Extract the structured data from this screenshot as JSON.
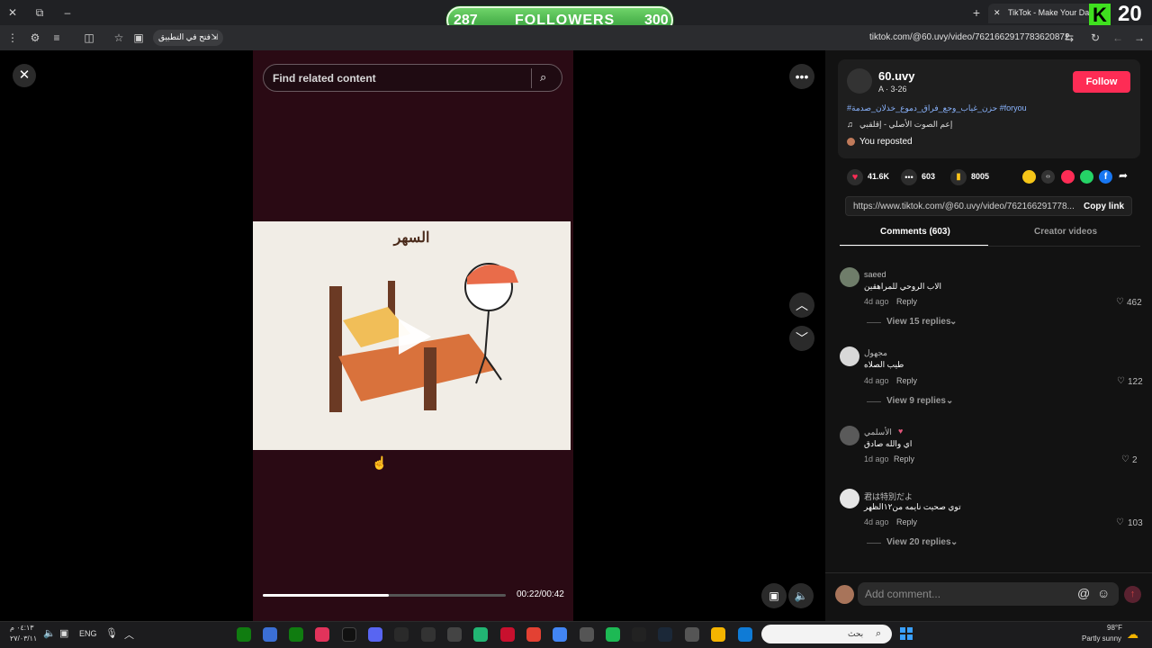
{
  "browser": {
    "tab_title": "TikTok - Make Your Day",
    "url": "tiktok.com/@60.uvy/video/7621662917783620872",
    "app_chip_label": "فتح في التطبيق",
    "new_tab_symbol": "+",
    "close_tab_symbol": "✕"
  },
  "overlay": {
    "followers_label": "FOLLOWERS",
    "followers_current": "287",
    "followers_goal": "300",
    "brand_number": "20",
    "brand_letter": "K"
  },
  "player": {
    "search_placeholder": "Find related content",
    "video_title_text": "السهر",
    "time": "00:22/00:42",
    "progress": 0.52
  },
  "author": {
    "username": "60.uvy",
    "subtitle": "A · 3-26",
    "follow_label": "Follow",
    "hashtags": "#حزن_غياب_وجع_فراق_دموع_خذلان_صدمة #foryou",
    "sound": "إعم الصوت الأصلي - إقلقبي",
    "repost_label": "You reposted"
  },
  "stats": {
    "likes": "41.6K",
    "comments": "603",
    "saves": "8005"
  },
  "share": {
    "link": "https://www.tiktok.com/@60.uvy/video/762166291778...",
    "copy_label": "Copy link"
  },
  "tabs": [
    {
      "label": "Comments (603)",
      "active": true
    },
    {
      "label": "Creator videos",
      "active": false
    }
  ],
  "comments": [
    {
      "name": "saeed",
      "text": "الاب الروحي للمراهقين",
      "age": "4d ago",
      "reply": "Reply",
      "likes": "462",
      "replies": "View 15 replies"
    },
    {
      "name": "مجهول",
      "text": "طيب الصلاه",
      "age": "4d ago",
      "reply": "Reply",
      "likes": "122",
      "replies": "View 9 replies"
    },
    {
      "name": "الأسلمي",
      "text": "اي والله صادق",
      "age": "1d ago",
      "reply": "Reply",
      "likes": "2",
      "replies": ""
    },
    {
      "name": "君は特別だよ",
      "text": "توي صحيت نايمه من١٢الظهر",
      "age": "4d ago",
      "reply": "Reply",
      "likes": "103",
      "replies": "View 20 replies"
    }
  ],
  "comment_box": {
    "placeholder": "Add comment..."
  },
  "taskbar": {
    "lang": "ENG",
    "time": "٠٤:١٣ م",
    "date": "٢٧/٠٣/١١",
    "search_text": "بحث",
    "weather_temp": "98°F",
    "weather_desc": "Partly sunny"
  },
  "colors": {
    "accent": "#fe2c55",
    "video_bg": "#2a0a14",
    "panel_bg": "#121212"
  }
}
